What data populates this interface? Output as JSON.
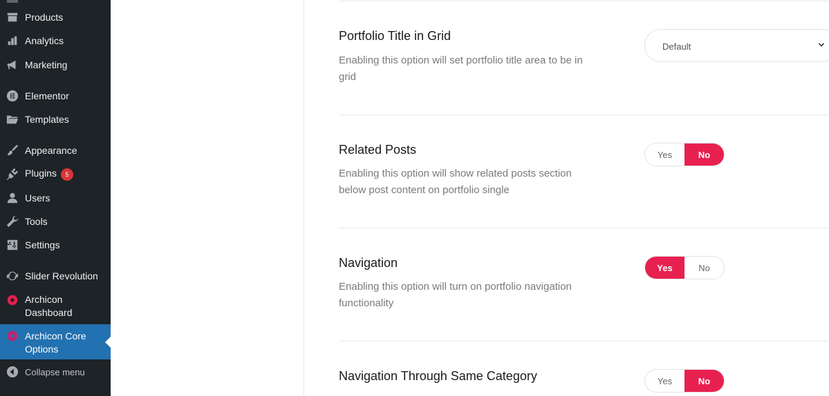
{
  "sidebar": {
    "items": [
      {
        "label": "Products",
        "icon": "archive-icon"
      },
      {
        "label": "Analytics",
        "icon": "bar-chart-icon"
      },
      {
        "label": "Marketing",
        "icon": "megaphone-icon"
      },
      {
        "label": "Elementor",
        "icon": "elementor-icon"
      },
      {
        "label": "Templates",
        "icon": "folder-icon"
      },
      {
        "label": "Appearance",
        "icon": "paintbrush-icon"
      },
      {
        "label": "Plugins",
        "icon": "plugin-icon",
        "badge": "5"
      },
      {
        "label": "Users",
        "icon": "user-icon"
      },
      {
        "label": "Tools",
        "icon": "wrench-icon"
      },
      {
        "label": "Settings",
        "icon": "settings-icon"
      },
      {
        "label": "Slider Revolution",
        "icon": "refresh-icon"
      },
      {
        "label": "Archicon Dashboard",
        "icon": "archicon-icon"
      },
      {
        "label": "Archicon Core Options",
        "icon": "archicon-icon",
        "active": true
      }
    ],
    "collapse_label": "Collapse menu"
  },
  "options": [
    {
      "title": "Portfolio Title in Grid",
      "description": "Enabling this option will set portfolio title area to be in grid",
      "control": "select",
      "value": "Default"
    },
    {
      "title": "Related Posts",
      "description": "Enabling this option will show related posts section below post content on portfolio single",
      "control": "toggle",
      "yes": "Yes",
      "no": "No",
      "selected": "No"
    },
    {
      "title": "Navigation",
      "description": "Enabling this option will turn on portfolio navigation functionality",
      "control": "toggle",
      "yes": "Yes",
      "no": "No",
      "selected": "Yes"
    },
    {
      "title": "Navigation Through Same Category",
      "description": "",
      "control": "toggle",
      "yes": "Yes",
      "no": "No",
      "selected": "No"
    }
  ],
  "colors": {
    "sidebar_bg": "#1d2327",
    "active_bg": "#2271b1",
    "accent": "#e8204f",
    "badge": "#d63638"
  }
}
